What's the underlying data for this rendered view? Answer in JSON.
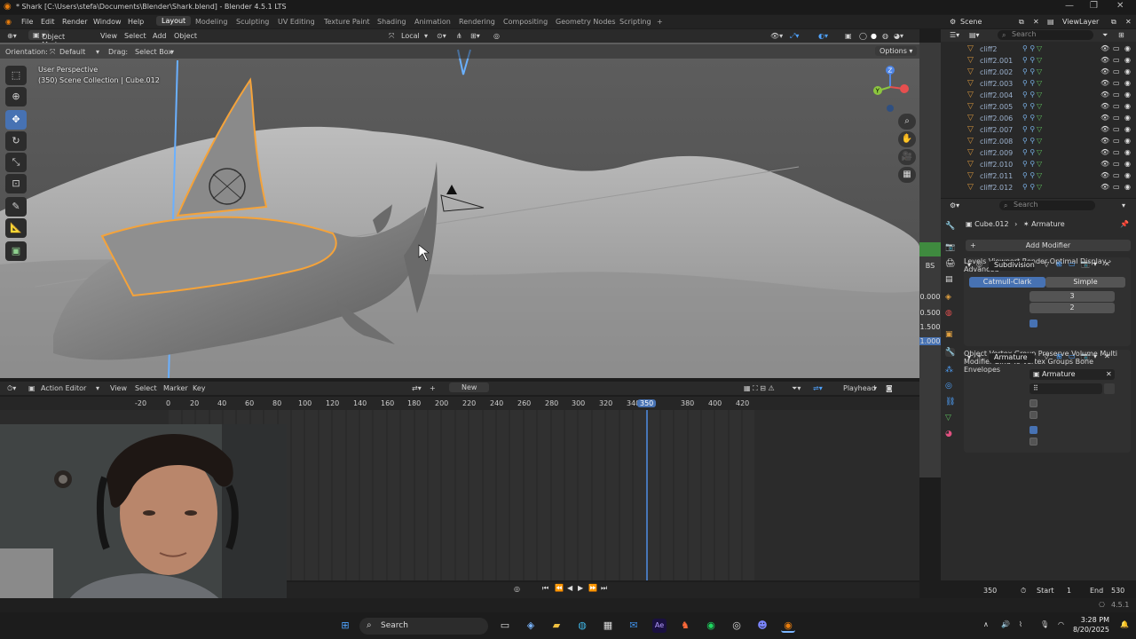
{
  "window": {
    "title": "* Shark [C:\\Users\\stefa\\Documents\\Blender\\Shark.blend] - Blender 4.5.1 LTS"
  },
  "menu": {
    "items": [
      "File",
      "Edit",
      "Render",
      "Window",
      "Help"
    ]
  },
  "workspaces": [
    "Layout",
    "Modeling",
    "Sculpting",
    "UV Editing",
    "Texture Paint",
    "Shading",
    "Animation",
    "Rendering",
    "Compositing",
    "Geometry Nodes",
    "Scripting"
  ],
  "active_workspace": "Layout",
  "scene": {
    "label": "Scene",
    "view_layer": "ViewLayer"
  },
  "viewport_header": {
    "mode": "Object Mode",
    "view": "View",
    "select": "Select",
    "add": "Add",
    "object": "Object",
    "pivot": "Local"
  },
  "viewport_tool": {
    "orientation_label": "Orientation:",
    "orientation": "Default",
    "drag_label": "Drag:",
    "drag": "Select Box",
    "options": "Options"
  },
  "viewport_info": {
    "perspective": "User Perspective",
    "collection": "(350) Scene Collection | Cube.012"
  },
  "sidebar_values": [
    "0.000",
    "0.500",
    "1.500",
    "1.000"
  ],
  "sidebar_tag": "BS",
  "outliner": {
    "search_placeholder": "Search",
    "items": [
      "cliff2",
      "cliff2.001",
      "cliff2.002",
      "cliff2.003",
      "cliff2.004",
      "cliff2.005",
      "cliff2.006",
      "cliff2.007",
      "cliff2.008",
      "cliff2.009",
      "cliff2.010",
      "cliff2.011",
      "cliff2.012"
    ]
  },
  "properties": {
    "search_placeholder": "Search",
    "breadcrumb_object": "Cube.012",
    "breadcrumb_modifier": "Armature",
    "add_modifier": "Add Modifier",
    "subdivision": {
      "name": "Subdivision",
      "method_a": "Catmull-Clark",
      "method_b": "Simple",
      "levels_viewport_label": "Levels Viewport",
      "levels_viewport": "3",
      "render_label": "Render",
      "render": "2",
      "optimal_display": "Optimal Display",
      "advanced": "Advanced"
    },
    "armature": {
      "name": "Armature",
      "object_label": "Object",
      "object": "Armature",
      "vertex_group_label": "Vertex Group",
      "preserve_volume": "Preserve Volume",
      "multi_modifier": "Multi Modifier",
      "bind_to_label": "Bind To",
      "vertex_groups": "Vertex Groups",
      "bone_envelopes": "Bone Envelopes"
    }
  },
  "timeline": {
    "editor": "Action Editor",
    "view": "View",
    "select": "Select",
    "marker": "Marker",
    "key": "Key",
    "new_action": "New",
    "playhead": "Playhead",
    "ticks": [
      "-20",
      "0",
      "20",
      "40",
      "60",
      "80",
      "100",
      "120",
      "140",
      "160",
      "180",
      "200",
      "220",
      "240",
      "260",
      "280",
      "300",
      "320",
      "340",
      "380",
      "400",
      "420"
    ],
    "current_frame": "350"
  },
  "frame_controls": {
    "current": "350",
    "start_label": "Start",
    "start": "1",
    "end_label": "End",
    "end": "530"
  },
  "status": {
    "version": "4.5.1"
  },
  "taskbar": {
    "search": "Search",
    "time": "3:28 PM",
    "date": "8/20/2025"
  }
}
